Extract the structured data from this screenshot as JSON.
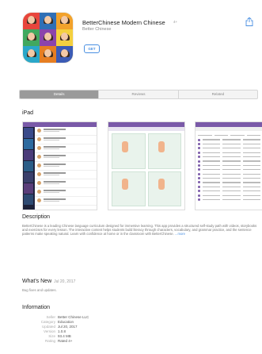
{
  "app": {
    "title": "BetterChinese Modern Chinese",
    "badge": "4+",
    "developer": "Better Chinese",
    "get_label": "GET"
  },
  "tabs": [
    {
      "label": "Details",
      "active": true
    },
    {
      "label": "Reviews",
      "active": false
    },
    {
      "label": "Related",
      "active": false
    }
  ],
  "screenshots": {
    "section_title": "iPad"
  },
  "description": {
    "title": "Description",
    "body": "BetterChinese is a leading Chinese language curriculum designed for immersive learning. This app provides a structured self-study path with videos, storybooks and exercises for every lesson. The interactive content helps students build literacy through characters, vocabulary, and grammar practice, and the sentence patterns make speaking natural. Learn with confidence at home or in the classroom with BetterChinese.",
    "more": "...more"
  },
  "whats_new": {
    "title": "What's New",
    "date": "Jul 20, 2017",
    "note": "Bug fixes and updates."
  },
  "information": {
    "title": "Information",
    "rows": [
      {
        "key": "Seller",
        "value": "Better Chinese LLC"
      },
      {
        "key": "Category",
        "value": "Education"
      },
      {
        "key": "Updated",
        "value": "Jul 20, 2017"
      },
      {
        "key": "Version",
        "value": "1.0.8"
      },
      {
        "key": "Size",
        "value": "93.4 MB"
      },
      {
        "key": "Rating",
        "value": "Rated 4+"
      }
    ]
  },
  "colors": {
    "accent": "#4a90e2",
    "app_theme": "#7a5aa8"
  }
}
